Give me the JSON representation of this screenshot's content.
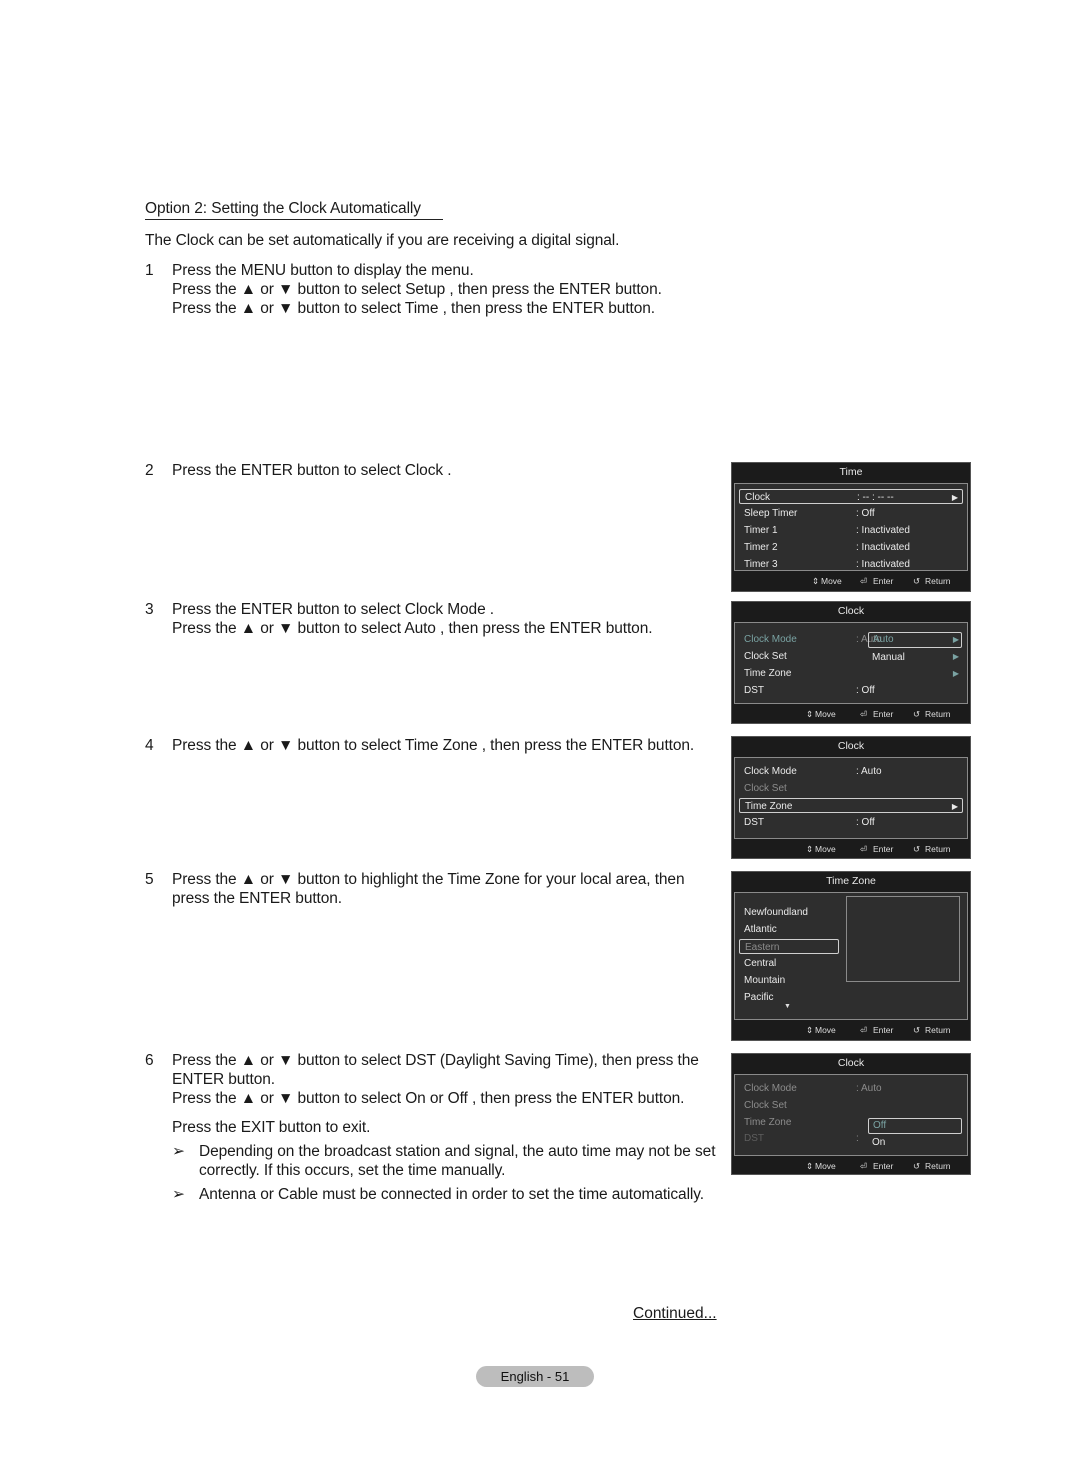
{
  "section_title": "Option 2: Setting the Clock Automatically",
  "intro": "The Clock can be set automatically if you are receiving a digital signal.",
  "steps": [
    {
      "number": "1",
      "lines": [
        "Press the MENU button to display the menu.",
        "Press the ▲ or ▼ button to select Setup , then press the ENTER button.",
        "Press the ▲ or ▼ button to select Time , then press the ENTER button."
      ]
    },
    {
      "number": "2",
      "lines": [
        "Press the ENTER button to select Clock ."
      ]
    },
    {
      "number": "3",
      "lines": [
        "Press the ENTER button to select Clock Mode .",
        "Press the ▲ or ▼ button to select Auto , then press the ENTER button."
      ]
    },
    {
      "number": "4",
      "lines": [
        "Press the ▲ or ▼ button to select Time Zone , then press the ENTER button."
      ]
    },
    {
      "number": "5",
      "lines": [
        "Press the ▲ or ▼ button to highlight the Time Zone  for your local area, then",
        "press the ENTER button."
      ]
    },
    {
      "number": "6",
      "lines": [
        "Press the ▲ or ▼ button to select DST (Daylight Saving Time), then press the",
        "ENTER button.",
        "Press the ▲ or ▼ button to select On or Off , then press the ENTER button."
      ]
    }
  ],
  "exit_text": "Press the EXIT button to exit.",
  "notes": [
    {
      "arrow": "➢",
      "lines": [
        "Depending on the broadcast station and signal, the auto time may not be set",
        "correctly. If this occurs, set the time manually."
      ]
    },
    {
      "arrow": "➢",
      "lines": [
        "Antenna or Cable must be connected in order to set the time automatically."
      ]
    }
  ],
  "continued": "Continued...",
  "page_label": "English - 51",
  "menu_footer": {
    "move": "Move",
    "enter": "Enter",
    "return": "Return",
    "move_icon": "⇕",
    "enter_icon": "⏎",
    "return_icon": "↺"
  },
  "menus": {
    "time": {
      "title": "Time",
      "rows": [
        {
          "label": "Clock",
          "value": ": -- : -- --",
          "arrow": "▶",
          "selected": true
        },
        {
          "label": "Sleep Timer",
          "value": ": Off"
        },
        {
          "label": "Timer 1",
          "value": ": Inactivated"
        },
        {
          "label": "Timer 2",
          "value": ": Inactivated"
        },
        {
          "label": "Timer 3",
          "value": ": Inactivated"
        }
      ]
    },
    "clock_mode_popup": {
      "title": "Clock",
      "rows": [
        {
          "label": "Clock Mode",
          "value": ": Auto",
          "arrow": "▶"
        },
        {
          "label": "Clock Set",
          "arrow": "▶"
        },
        {
          "label": "Time Zone",
          "arrow": "▶"
        },
        {
          "label": "DST",
          "value": ": Off"
        }
      ],
      "popup_options": [
        "Auto",
        "Manual"
      ],
      "popup_selected": "Auto"
    },
    "clock_timezone": {
      "title": "Clock",
      "rows": [
        {
          "label": "Clock Mode",
          "value": ": Auto"
        },
        {
          "label": "Clock Set"
        },
        {
          "label": "Time Zone",
          "arrow": "▶",
          "selected": true
        },
        {
          "label": "DST",
          "value": ": Off"
        }
      ]
    },
    "time_zone": {
      "title": "Time Zone",
      "zones": [
        "Newfoundland",
        "Atlantic",
        "Eastern",
        "Central",
        "Mountain",
        "Pacific"
      ],
      "selected": "Eastern",
      "more_icon": "▼"
    },
    "clock_dst_popup": {
      "title": "Clock",
      "rows": [
        {
          "label": "Clock Mode",
          "value": ": Auto"
        },
        {
          "label": "Clock Set"
        },
        {
          "label": "Time Zone"
        },
        {
          "label": "DST",
          "value": ":"
        }
      ],
      "popup_options": [
        "Off",
        "On"
      ],
      "popup_selected": "Off"
    }
  }
}
